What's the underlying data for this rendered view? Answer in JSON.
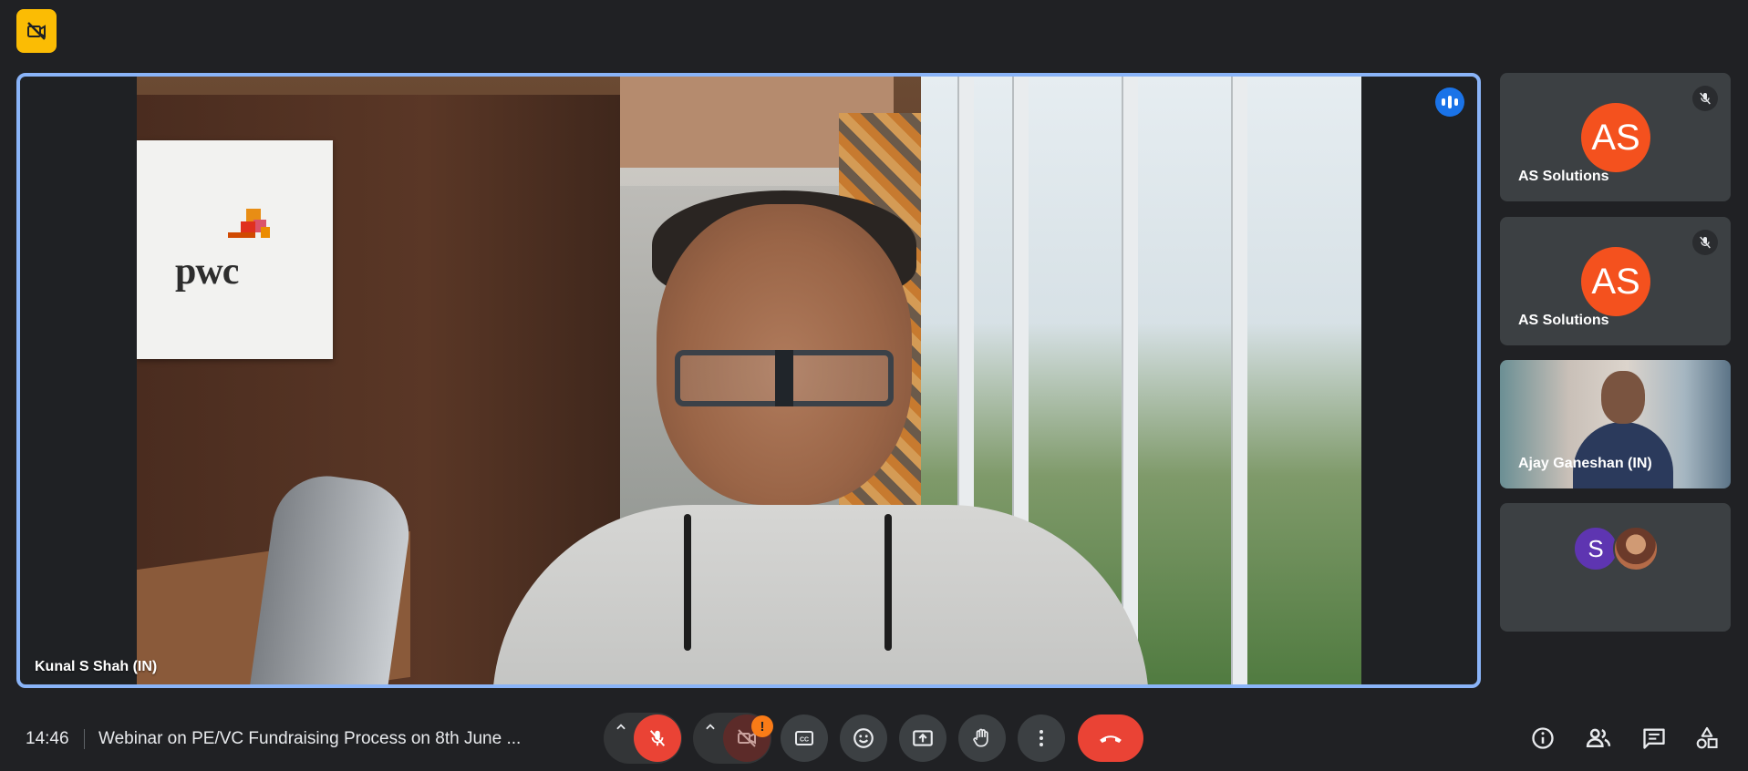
{
  "stage": {
    "speaker_name": "Kunal S Shah (IN)",
    "logo_text": "pwc"
  },
  "tiles": [
    {
      "initials": "AS",
      "name": "AS Solutions",
      "muted": true
    },
    {
      "initials": "AS",
      "name": "AS Solutions",
      "muted": true
    },
    {
      "name": "Ajay Ganeshan (IN)"
    },
    {
      "initial": "S"
    }
  ],
  "bottom": {
    "time": "14:46",
    "meeting_title": "Webinar on PE/VC Fundraising Process on 8th June ...",
    "camera_warning": "!"
  },
  "colors": {
    "background": "#202124",
    "accent_border": "#8ab4f8",
    "avatar_orange": "#f4511e",
    "avatar_purple": "#5e35b1",
    "danger": "#ea4335",
    "warning": "#fa7b17",
    "badge_yellow": "#fbbc04"
  },
  "icons": {
    "top_badge": "no-video-icon",
    "speaking": "speaking-indicator-icon",
    "tile_mute": "mic-off-icon",
    "mic": "mic-off-icon",
    "camera": "camera-off-icon",
    "captions": "captions-icon",
    "emoji": "emoji-icon",
    "present": "present-screen-icon",
    "hand": "raise-hand-icon",
    "more": "more-options-icon",
    "leave": "leave-call-icon",
    "info": "info-icon",
    "people": "people-icon",
    "chat": "chat-icon",
    "activities": "activities-icon"
  }
}
